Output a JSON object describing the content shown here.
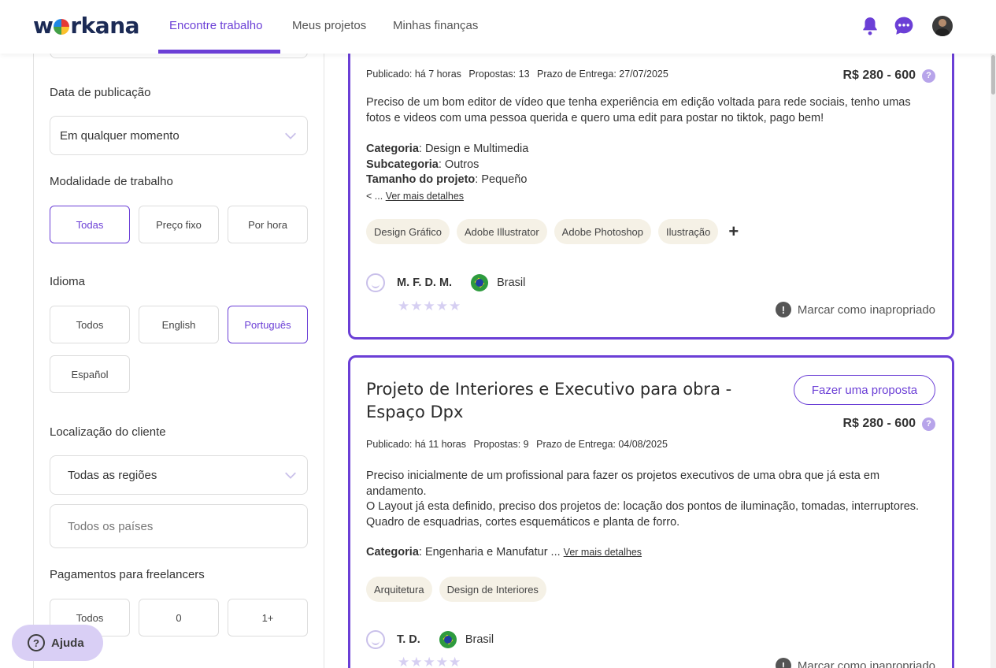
{
  "header": {
    "logo": {
      "before": "w",
      "after": "rkana"
    },
    "nav": [
      {
        "label": "Encontre trabalho",
        "active": true
      },
      {
        "label": "Meus projetos"
      },
      {
        "label": "Minhas finanças"
      }
    ],
    "accent_color": "#6b3fd6"
  },
  "sidebar": {
    "publication": {
      "label": "Data de publicação",
      "value": "Em qualquer momento"
    },
    "modality": {
      "label": "Modalidade de trabalho",
      "options": [
        "Todas",
        "Preço fixo",
        "Por hora"
      ],
      "selected": "Todas"
    },
    "language": {
      "label": "Idioma",
      "options": [
        "Todos",
        "English",
        "Português",
        "Español"
      ],
      "selected": "Português"
    },
    "location": {
      "label": "Localização do cliente",
      "region": "Todas as regiões",
      "country_placeholder": "Todos os países"
    },
    "payments": {
      "label": "Pagamentos para freelancers",
      "options": [
        "Todos",
        "0",
        "1+"
      ]
    }
  },
  "help": {
    "label": "Ajuda"
  },
  "projects": [
    {
      "published": "Publicado: há 7 horas",
      "proposals": "Propostas: 13",
      "deadline": "Prazo de Entrega: 27/07/2025",
      "price": "R$ 280 - 600",
      "description": "Preciso de um bom editor de vídeo que tenha experiência em edição voltada para rede sociais, tenho umas fotos e videos com uma pessoa querida e quero uma edit para postar no tiktok, pago bem!",
      "category_label": "Categoria",
      "category": ": Design e Multimedia",
      "subcategory_label": "Subcategoria",
      "subcategory": ": Outros",
      "size_label": "Tamanho do projeto",
      "size": ": Pequeño",
      "less": "< ...",
      "more_link": "Ver mais detalhes",
      "tags": [
        "Design Gráfico",
        "Adobe Illustrator",
        "Adobe Photoshop",
        "Ilustração"
      ],
      "plus": "+",
      "client": "M. F. D. M.",
      "country": "Brasil",
      "stars": "★★★★★",
      "report": "Marcar como inapropriado"
    },
    {
      "title": "Projeto de Interiores e Executivo para obra - Espaço Dpx",
      "proposal_button": "Fazer uma proposta",
      "published": "Publicado: há 11 horas",
      "proposals": "Propostas: 9",
      "deadline": "Prazo de Entrega: 04/08/2025",
      "price": "R$ 280 - 600",
      "description_lines": [
        "Preciso inicialmente de um profissional para fazer os projetos executivos de uma obra que já esta em andamento.",
        "O Layout já esta definido, preciso dos projetos de: locação dos pontos de iluminação, tomadas, interruptores. Quadro de esquadrias, cortes esquemáticos e planta de forro."
      ],
      "category_label": "Categoria",
      "category": ": Engenharia e Manufatur ...",
      "more_link": "Ver mais detalhes",
      "tags": [
        "Arquitetura",
        "Design de Interiores"
      ],
      "client": "T. D.",
      "country": "Brasil",
      "stars": "★★★★★",
      "report": "Marcar como inapropriado"
    }
  ]
}
